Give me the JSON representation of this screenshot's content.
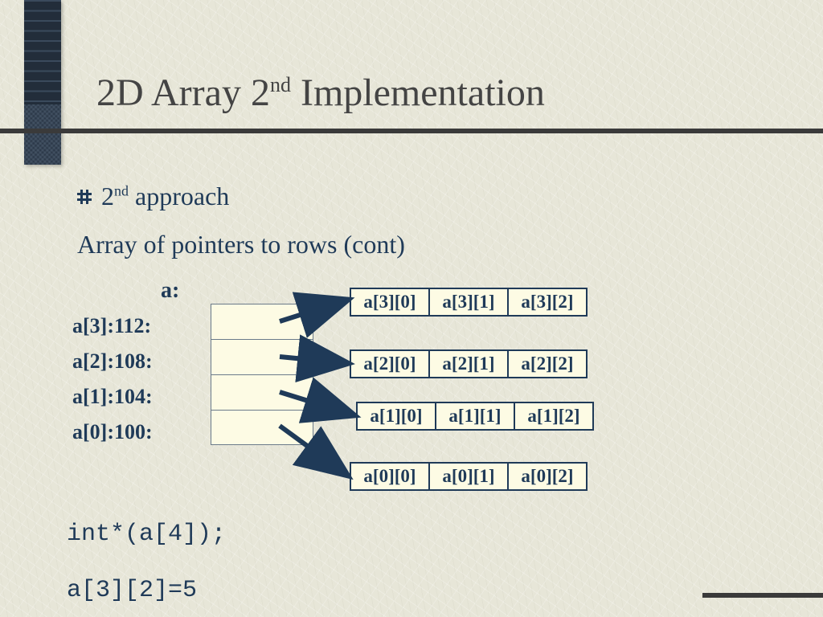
{
  "title": {
    "pre": "2D Array 2",
    "sup": "nd",
    "post": " Implementation"
  },
  "bullet": {
    "pre": "2",
    "sup": "nd",
    "post": " approach"
  },
  "subtitle": "Array of pointers to rows (cont)",
  "pointer_block": {
    "header": "a:",
    "rows": [
      {
        "label": "a[3]:112:"
      },
      {
        "label": "a[2]:108:"
      },
      {
        "label": "a[1]:104:"
      },
      {
        "label": "a[0]:100:"
      }
    ]
  },
  "data_rows": {
    "row3": [
      "a[3][0]",
      "a[3][1]",
      "a[3][2]"
    ],
    "row2": [
      "a[2][0]",
      "a[2][1]",
      "a[2][2]"
    ],
    "row1": [
      "a[1][0]",
      "a[1][1]",
      "a[1][2]"
    ],
    "row0": [
      "a[0][0]",
      "a[0][1]",
      "a[0][2]"
    ]
  },
  "code": {
    "decl": "int*(a[4]);",
    "assign": "a[3][2]=5"
  }
}
